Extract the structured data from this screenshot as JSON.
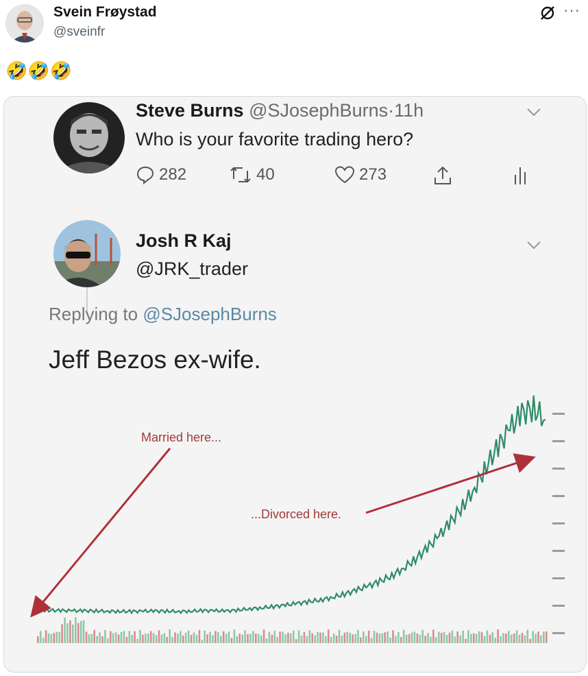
{
  "post": {
    "author_name": "Svein Frøystad",
    "author_handle": "@sveinfr",
    "text": "🤣🤣🤣"
  },
  "icons": {
    "grok": "grok-slash-icon",
    "more": "more-icon",
    "more_glyph": "···"
  },
  "quoted_tweet": {
    "author_name": "Steve Burns",
    "author_handle": "@SJosephBurns",
    "separator": "·",
    "time": "11h",
    "text": "Who is your favorite trading hero?",
    "stats": {
      "replies": "282",
      "retweets": "40",
      "likes": "273"
    }
  },
  "reply_tweet": {
    "author_name": "Josh R Kaj",
    "author_handle": "@JRK_trader",
    "replying_prefix": "Replying to",
    "replying_to": "@SJosephBurns",
    "text": "Jeff Bezos ex-wife."
  },
  "chart_data": {
    "type": "line",
    "annotations": [
      {
        "text": "Married here...",
        "points_to": "start of series"
      },
      {
        "text": "...Divorced here.",
        "points_to": "peak of series"
      }
    ],
    "series": [
      {
        "values": [
          50,
          49,
          48,
          47,
          47,
          46,
          45,
          44,
          44,
          45,
          46,
          45,
          44,
          45,
          48,
          47,
          46,
          50,
          56,
          60,
          66,
          72,
          80,
          88,
          96,
          108,
          122,
          140,
          158,
          180,
          205,
          240,
          280,
          330,
          385,
          450,
          520,
          600,
          700,
          790,
          870,
          940,
          960,
          910
        ]
      }
    ],
    "grid": false
  }
}
